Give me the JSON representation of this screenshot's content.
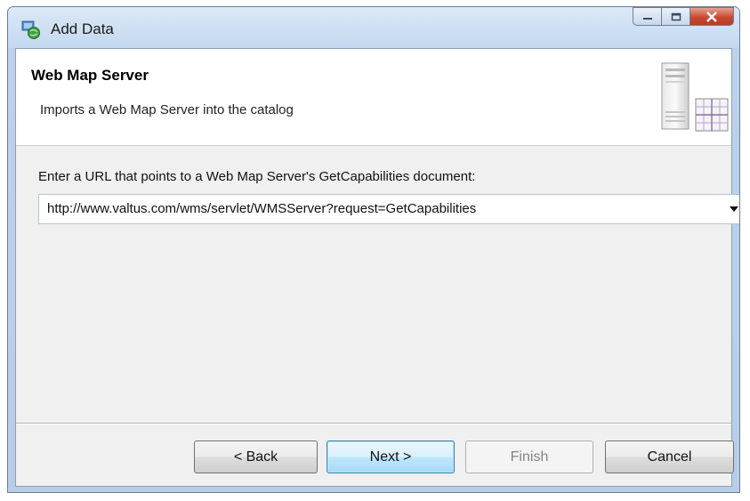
{
  "window": {
    "title": "Add Data",
    "icon": "add-data-icon",
    "controls": {
      "minimize": "minimize-icon",
      "maximize": "maximize-icon",
      "close": "close-icon"
    }
  },
  "header": {
    "title": "Web Map Server",
    "description": "Imports a Web Map Server into the catalog",
    "graphic": "server-icon"
  },
  "form": {
    "url_label": "Enter a URL that points to a Web Map Server's GetCapabilities document:",
    "url_value": "http://www.valtus.com/wms/servlet/WMSServer?request=GetCapabilities"
  },
  "buttons": {
    "back": "< Back",
    "next": "Next >",
    "finish": "Finish",
    "cancel": "Cancel"
  },
  "colors": {
    "titlebar": "#c3d8f0",
    "close_button": "#c74a33",
    "default_button_border": "#3c7fb1",
    "disabled_text": "#838383"
  }
}
